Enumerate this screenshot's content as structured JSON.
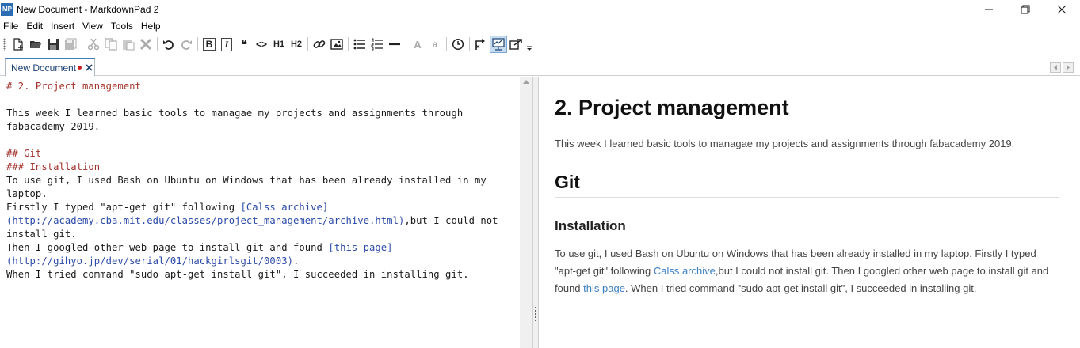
{
  "window": {
    "app_icon": "MP",
    "title": "New Document - MarkdownPad 2"
  },
  "menu": {
    "items": [
      "File",
      "Edit",
      "Insert",
      "View",
      "Tools",
      "Help"
    ]
  },
  "toolbar": {
    "buttons": [
      "new-document-icon",
      "open-folder-icon",
      "save-icon",
      "save-all-icon",
      "cut-icon",
      "copy-icon",
      "paste-icon",
      "delete-icon",
      "undo-icon",
      "redo-icon",
      "bold-icon",
      "italic-icon",
      "quote-icon",
      "code-icon",
      "heading1-icon",
      "heading2-icon",
      "hyperlink-icon",
      "image-icon",
      "unordered-list-icon",
      "ordered-list-icon",
      "horizontal-rule-icon",
      "uppercase-icon",
      "lowercase-icon",
      "timestamp-icon",
      "preview-toggle-icon",
      "live-preview-icon",
      "export-icon",
      "toolbar-overflow-icon"
    ],
    "bold_label": "B",
    "italic_label": "I",
    "quote_label": "❝",
    "code_label": "<>",
    "h1_label": "H1",
    "h2_label": "H2",
    "uppercase_label": "A",
    "lowercase_label": "a",
    "active_button": "live-preview-icon",
    "active_color": "#c8dcf0"
  },
  "tabs": [
    {
      "label": "New Document",
      "modified": true
    }
  ],
  "editor": {
    "line1": "# 2. Project management",
    "line2": "This week I learned basic tools to managae my projects and assignments through fabacademy 2019.",
    "line3": "## Git",
    "line4": "### Installation",
    "line5": "To use git, I used Bash on Ubuntu on Windows that has been already installed in my laptop.",
    "line6_start": "Firstly I typed \"apt-get git\" following ",
    "line6_link": "[Calss archive](http://academy.cba.mit.edu/classes/project_management/archive.html)",
    "line6_end": ",but I could not install git.",
    "line7_start": "Then I googled other web page to install git and found ",
    "line7_link": "[this page](http://gihyo.jp/dev/serial/01/hackgirlsgit/0003)",
    "line7_end": ".",
    "line8": "When I tried command \"sudo apt-get install git\", I succeeded in installing git.",
    "heading_color": "#a3322a",
    "link_color": "#2b4aa8"
  },
  "preview": {
    "h1": "2. Project management",
    "p1": "This week I learned basic tools to managae my projects and assignments through fabacademy 2019.",
    "h2": "Git",
    "h3": "Installation",
    "p2_a": "To use git, I used Bash on Ubuntu on Windows that has been already installed in my laptop. Firstly I typed \"apt-get git\" following ",
    "p2_link1": "Calss archive",
    "p2_b": ",but I could not install git. Then I googled other web page to install git and found ",
    "p2_link2": "this page",
    "p2_c": ". When I tried command \"sudo apt-get install git\", I succeeded in installing git.",
    "link_color": "#3b7ec0"
  }
}
